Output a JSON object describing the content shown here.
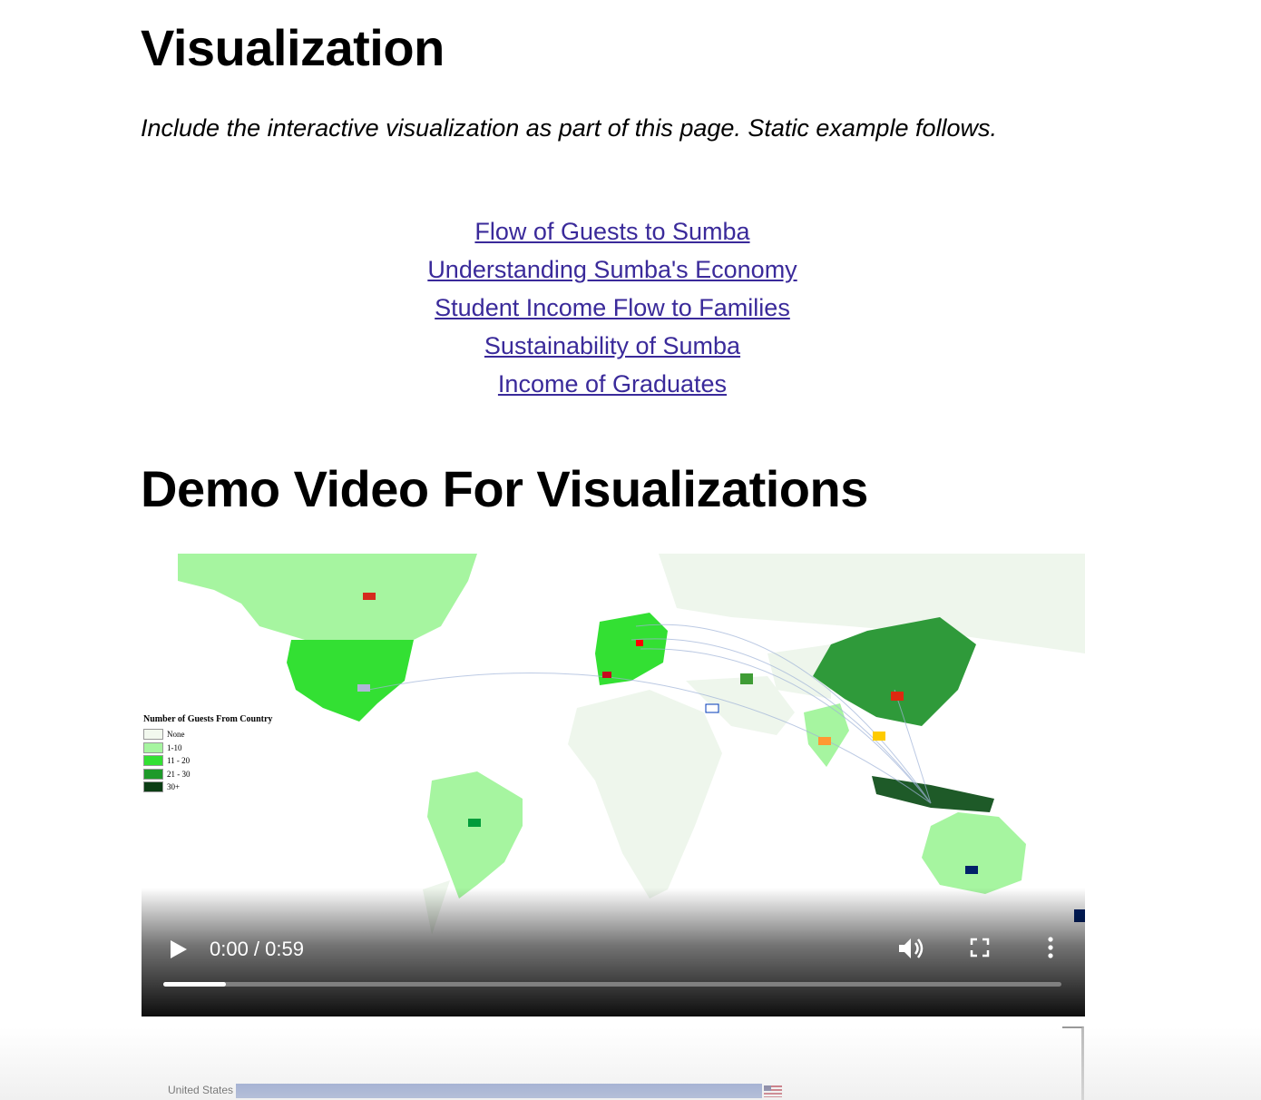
{
  "headings": {
    "visualization": "Visualization",
    "demo": "Demo Video For Visualizations"
  },
  "intro": "Include the interactive visualization as part of this page. Static example follows.",
  "links": [
    "Flow of Guests to Sumba",
    "Understanding Sumba's Economy",
    "Student Income Flow to Families",
    "Sustainability of Sumba",
    "Income of Graduates"
  ],
  "video": {
    "time": "0:00 / 0:59",
    "progress": 0.07,
    "legend": {
      "title": "Number of Guests From Country",
      "items": [
        {
          "label": "None",
          "color": "#f2f8ee"
        },
        {
          "label": "1-10",
          "color": "#a6f5a0"
        },
        {
          "label": "11 - 20",
          "color": "#33e033"
        },
        {
          "label": "21 - 30",
          "color": "#1e9a2a"
        },
        {
          "label": "30+",
          "color": "#0b3d14"
        }
      ]
    }
  },
  "bar_preview": {
    "label": "United States",
    "fraction": 0.58
  },
  "colors": {
    "link": "#3a2a9a",
    "bar": "#6f87c4",
    "none": "#eef6ec",
    "light": "#a6f5a0",
    "mid": "#33e033",
    "dark": "#2f9a3a"
  },
  "icons": [
    "play-icon",
    "volume-icon",
    "fullscreen-icon",
    "more-options-icon",
    "us-flag-icon"
  ]
}
